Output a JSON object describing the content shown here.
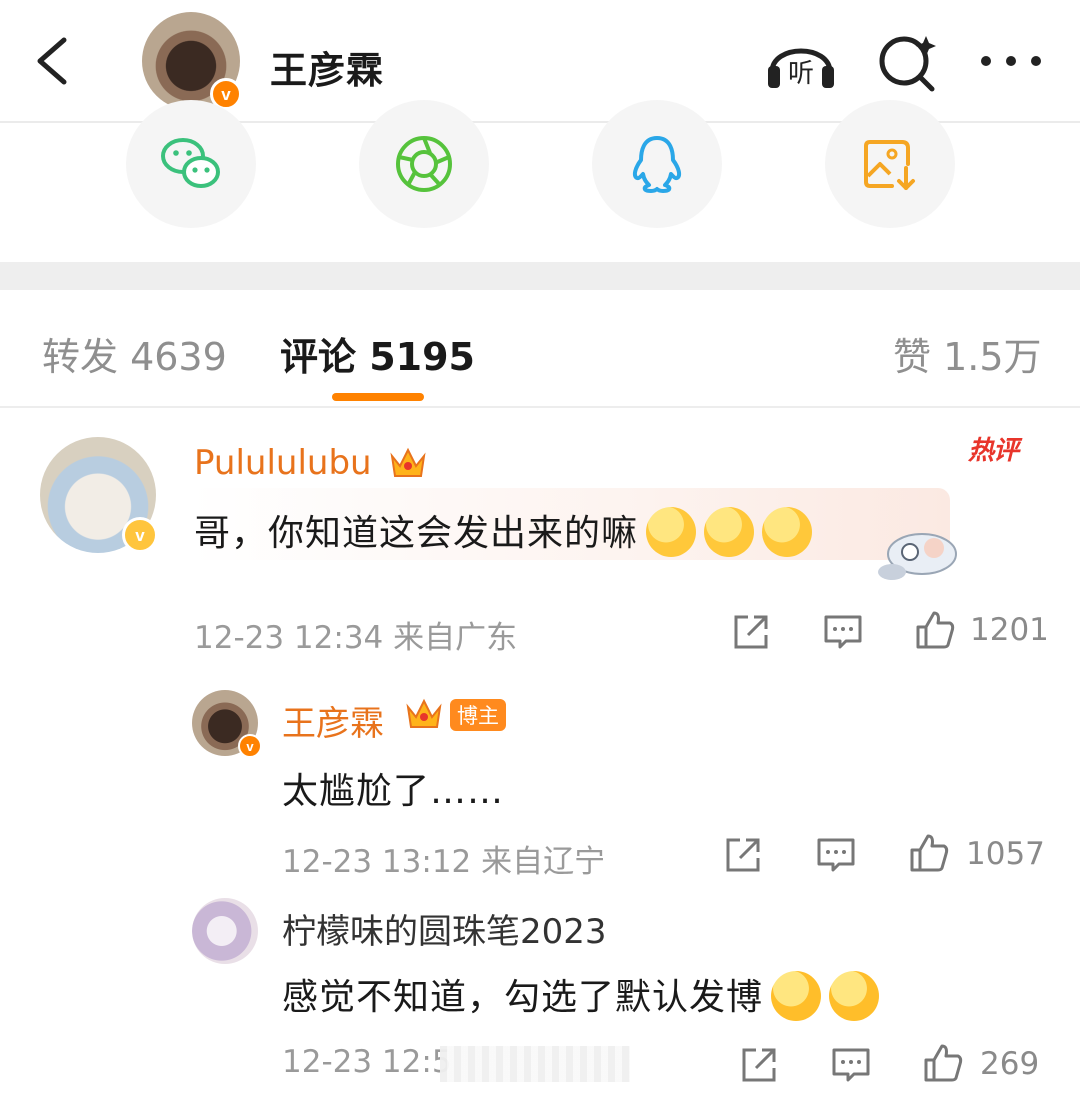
{
  "header": {
    "author_name": "王彦霖",
    "verified_mark": "v",
    "icons": [
      "back-arrow-icon",
      "listen-icon",
      "search-icon",
      "more-icon"
    ],
    "listen_label": "听"
  },
  "share": {
    "targets": [
      "wechat-icon",
      "moments-icon",
      "qq-icon",
      "save-image-icon"
    ],
    "colors": {
      "wechat": "#3bc17c",
      "moments": "#56c33c",
      "qq": "#2aa7e8",
      "save": "#f5a623"
    }
  },
  "tabs": [
    {
      "label": "转发 4639",
      "active": false
    },
    {
      "label": "评论 5195",
      "active": true
    },
    {
      "label": "赞 1.5万",
      "active": false
    }
  ],
  "accent_color": "#ff8200",
  "comments": [
    {
      "user": "Pulululubu",
      "hot_tag": "热评",
      "text": "哥，你知道这会发出来的嘛",
      "emoji_count": 3,
      "meta": "12-23 12:34 来自广东",
      "likes": "1201"
    },
    {
      "user": "王彦霖",
      "badge": "博主",
      "text": "太尴尬了……",
      "meta": "12-23 13:12 来自辽宁",
      "likes": "1057"
    },
    {
      "user": "柠檬味的圆珠笔2023",
      "text": "感觉不知道，勾选了默认发博",
      "emoji_count": 2,
      "meta": "12-23 12:5",
      "likes": "269"
    }
  ]
}
